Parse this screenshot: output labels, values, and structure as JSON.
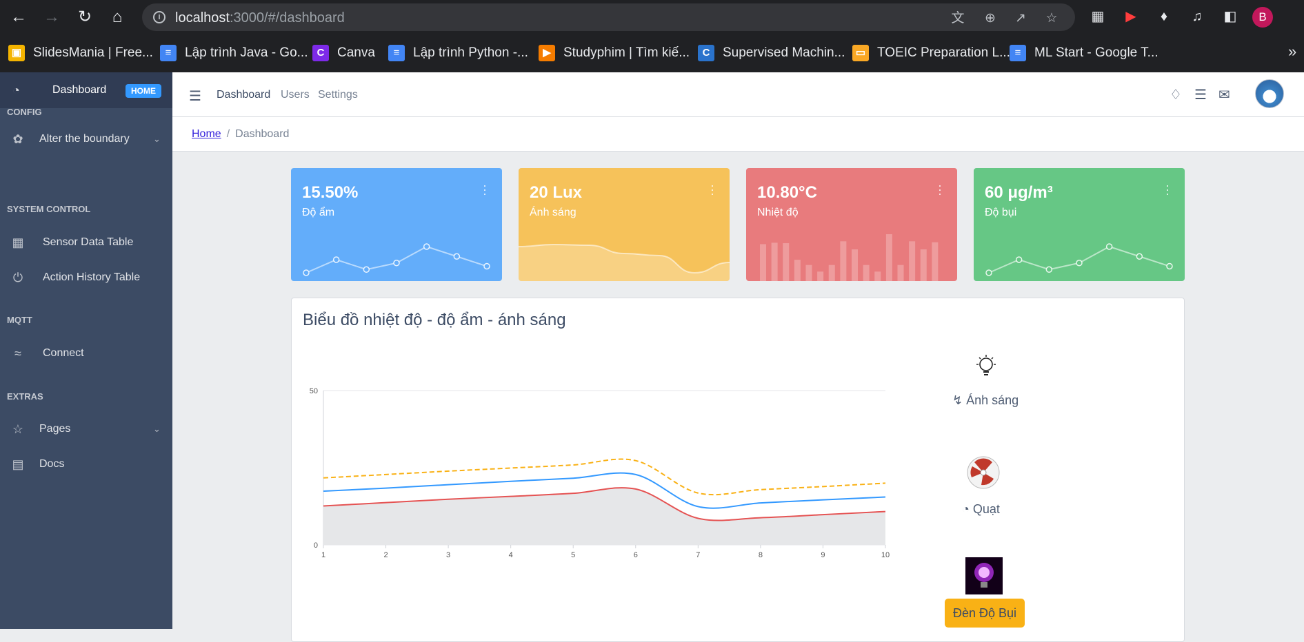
{
  "browser": {
    "url_host": "localhost",
    "url_rest": ":3000/#/dashboard",
    "profile_initial": "B",
    "bookmarks": [
      {
        "label": "SlidesMania | Free...",
        "icon": "slidesmania-icon",
        "color": "#f4b400"
      },
      {
        "label": "Lập trình Java - Go...",
        "icon": "docs-icon",
        "color": "#4285f4"
      },
      {
        "label": "Canva",
        "icon": "canva-icon",
        "color": "#7d2ae8"
      },
      {
        "label": "Lập trình Python -...",
        "icon": "docs-icon",
        "color": "#4285f4"
      },
      {
        "label": "Studyphim | Tìm kiế...",
        "icon": "studyphim-icon",
        "color": "#f57c00"
      },
      {
        "label": "Supervised Machin...",
        "icon": "coursera-icon",
        "color": "#2a73cc"
      },
      {
        "label": "TOEIC Preparation L...",
        "icon": "book-icon",
        "color": "#f9a825"
      },
      {
        "label": "ML Start - Google T...",
        "icon": "docs-icon",
        "color": "#4285f4"
      }
    ]
  },
  "sidebar": {
    "brand": {
      "label": "Dashboard",
      "badge": "HOME"
    },
    "sections": [
      {
        "title": "CONFIG"
      },
      {
        "title": "SYSTEM CONTROL"
      },
      {
        "title": "MQTT"
      },
      {
        "title": "EXTRAS"
      }
    ],
    "items": [
      {
        "label": "Alter the boundary",
        "icon": "puzzle-icon",
        "chevron": true
      },
      {
        "label": "Sensor Data Table",
        "icon": "calculator-icon",
        "chevron": false
      },
      {
        "label": "Action History Table",
        "icon": "power-icon",
        "chevron": false
      },
      {
        "label": "Connect",
        "icon": "wifi-icon",
        "chevron": false
      },
      {
        "label": "Pages",
        "icon": "star-icon",
        "chevron": true
      },
      {
        "label": "Docs",
        "icon": "document-icon",
        "chevron": false
      }
    ]
  },
  "header": {
    "nav": [
      {
        "label": "Dashboard"
      },
      {
        "label": "Users"
      },
      {
        "label": "Settings"
      }
    ]
  },
  "breadcrumb": {
    "home": "Home",
    "current": "Dashboard"
  },
  "cards": [
    {
      "value": "15.50%",
      "label": "Độ ẩm",
      "color": "#63adfa",
      "chart": "line",
      "series": [
        2,
        4,
        2.5,
        3.5,
        6,
        4.5,
        3
      ]
    },
    {
      "value": "20 Lux",
      "label": "Ánh sáng",
      "color": "#f6c25a",
      "chart": "area",
      "series": [
        78,
        81,
        80,
        68,
        65,
        40,
        55
      ]
    },
    {
      "value": "10.80°C",
      "label": "Nhiệt độ",
      "color": "#e87b7d",
      "chart": "bar",
      "series": [
        78,
        81,
        80,
        45,
        34,
        20,
        34,
        84,
        67,
        34,
        20,
        99,
        34,
        84,
        67,
        82
      ]
    },
    {
      "value": "60 μg/m³",
      "label": "Độ bụi",
      "color": "#66c785",
      "chart": "line",
      "series": [
        2,
        4,
        2.5,
        3.5,
        6,
        4.5,
        3
      ]
    }
  ],
  "main_chart": {
    "title": "Biểu đồ nhiệt độ - độ ẩm - ánh sáng",
    "devices": [
      {
        "label": "Ánh sáng",
        "icon": "lightbulb-icon",
        "label_icon": "bolt-icon"
      },
      {
        "label": "Quạt",
        "icon": "fan-icon",
        "label_icon": "speedometer-icon"
      },
      {
        "label": "Đèn Độ Bụi",
        "icon": "purple-bulb-icon"
      }
    ]
  },
  "chart_data": {
    "type": "line",
    "title": "",
    "x": [
      1,
      2,
      3,
      4,
      5,
      6,
      7,
      8,
      9,
      10
    ],
    "ylim": [
      0,
      50
    ],
    "yticks": [
      0,
      50
    ],
    "grid": true,
    "series": [
      {
        "values": [
          12.6,
          13.7,
          14.8,
          15.7,
          16.7,
          18.1,
          8.6,
          8.8,
          9.8,
          10.8
        ],
        "color": "#e55353",
        "fill": true
      },
      {
        "values": [
          17.4,
          18.4,
          19.5,
          20.6,
          21.6,
          22.8,
          12.4,
          13.6,
          14.6,
          15.5
        ],
        "color": "#3399ff",
        "fill": false
      },
      {
        "values": [
          21.7,
          22.8,
          23.9,
          24.9,
          25.9,
          27.3,
          16.8,
          17.9,
          18.9,
          20.0
        ],
        "color": "#f9b115",
        "fill": false,
        "dashed": true
      }
    ]
  }
}
